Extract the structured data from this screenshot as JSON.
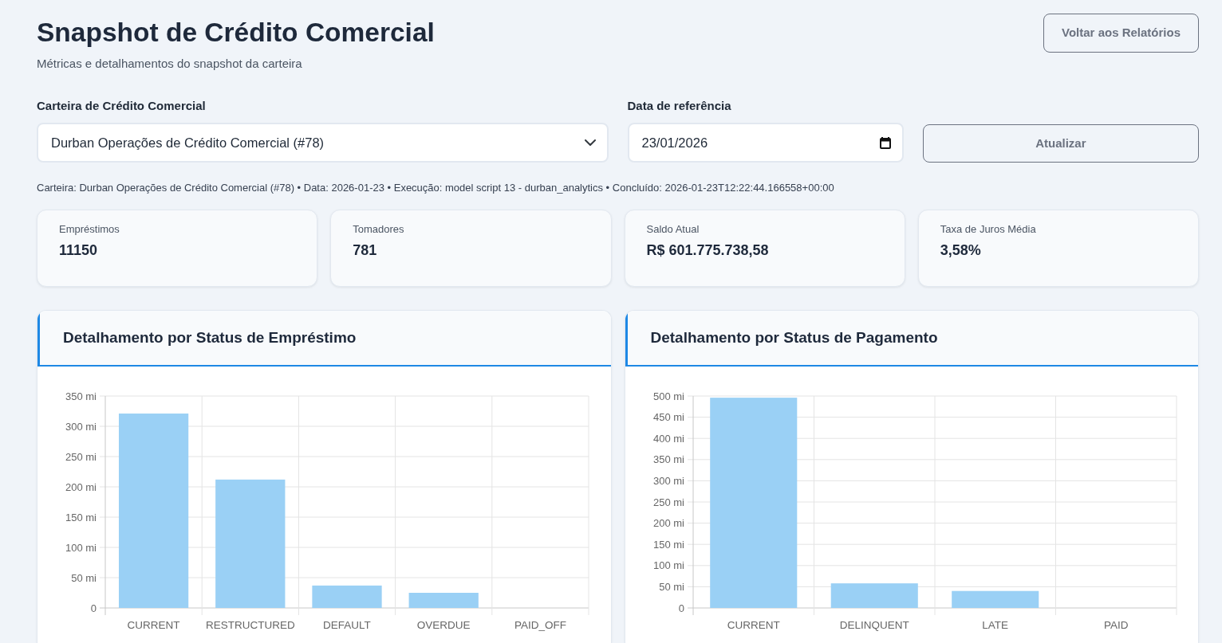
{
  "header": {
    "title": "Snapshot de Crédito Comercial",
    "subtitle": "Métricas e detalhamentos do snapshot da carteira",
    "back_button": "Voltar aos Relatórios"
  },
  "filters": {
    "portfolio": {
      "label": "Carteira de Crédito Comercial",
      "value": "Durban Operações de Crédito Comercial (#78)"
    },
    "date": {
      "label": "Data de referência",
      "value": "23/01/2026"
    },
    "refresh_button": "Atualizar"
  },
  "meta_line": "Carteira: Durban Operações de Crédito Comercial (#78) • Data: 2026-01-23 • Execução: model script 13 - durban_analytics • Concluído: 2026-01-23T12:22:44.166558+00:00",
  "metrics": [
    {
      "label": "Empréstimos",
      "value": "11150"
    },
    {
      "label": "Tomadores",
      "value": "781"
    },
    {
      "label": "Saldo Atual",
      "value": "R$ 601.775.738,58"
    },
    {
      "label": "Taxa de Juros Média",
      "value": "3,58%"
    }
  ],
  "panels": [
    {
      "title": "Detalhamento por Status de Empréstimo",
      "chart_data": {
        "type": "bar",
        "categories": [
          "CURRENT",
          "RESTRUCTURED",
          "DEFAULT",
          "OVERDUE",
          "PAID_OFF"
        ],
        "series": [
          {
            "color": "#9ad0f5",
            "values": [
              321,
              212,
              37,
              25,
              0
            ]
          }
        ],
        "ylim": [
          0,
          350
        ],
        "yticks": [
          {
            "value": 0,
            "label": "0"
          },
          {
            "value": 50,
            "label": "50 mi"
          },
          {
            "value": 100,
            "label": "100 mi"
          },
          {
            "value": 150,
            "label": "150 mi"
          },
          {
            "value": 200,
            "label": "200 mi"
          },
          {
            "value": 250,
            "label": "250 mi"
          },
          {
            "value": 300,
            "label": "300 mi"
          },
          {
            "value": 350,
            "label": "350 mi"
          }
        ],
        "grid": true
      }
    },
    {
      "title": "Detalhamento por Status de Pagamento",
      "chart_data": {
        "type": "bar",
        "categories": [
          "CURRENT",
          "DELINQUENT",
          "LATE",
          "PAID"
        ],
        "series": [
          {
            "color": "#9ad0f5",
            "values": [
              496,
              58,
              40,
              0
            ]
          }
        ],
        "ylim": [
          0,
          500
        ],
        "yticks": [
          {
            "value": 0,
            "label": "0"
          },
          {
            "value": 50,
            "label": "50 mi"
          },
          {
            "value": 100,
            "label": "100 mi"
          },
          {
            "value": 150,
            "label": "150 mi"
          },
          {
            "value": 200,
            "label": "200 mi"
          },
          {
            "value": 250,
            "label": "250 mi"
          },
          {
            "value": 300,
            "label": "300 mi"
          },
          {
            "value": 350,
            "label": "350 mi"
          },
          {
            "value": 400,
            "label": "400 mi"
          },
          {
            "value": 450,
            "label": "450 mi"
          },
          {
            "value": 500,
            "label": "500 mi"
          }
        ],
        "grid": true
      }
    }
  ]
}
